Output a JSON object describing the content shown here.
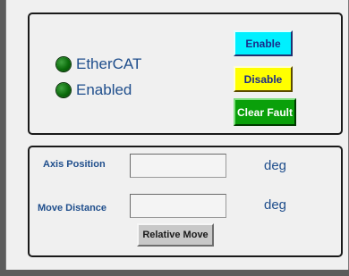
{
  "status": {
    "ethercat_label": "EtherCAT",
    "enabled_label": "Enabled",
    "led_color": "#0b6b0b"
  },
  "buttons": {
    "enable": "Enable",
    "disable": "Disable",
    "clear_fault": "Clear Fault",
    "relative_move": "Relative Move"
  },
  "motion": {
    "axis_position_label": "Axis Position",
    "axis_position_value": "",
    "axis_position_unit": "deg",
    "move_distance_label": "Move Distance",
    "move_distance_value": "",
    "move_distance_unit": "deg"
  },
  "colors": {
    "enable_bg": "#00f0ff",
    "disable_bg": "#ffff00",
    "clear_fault_bg": "#0aa00a",
    "label_text": "#1f4e8c"
  }
}
